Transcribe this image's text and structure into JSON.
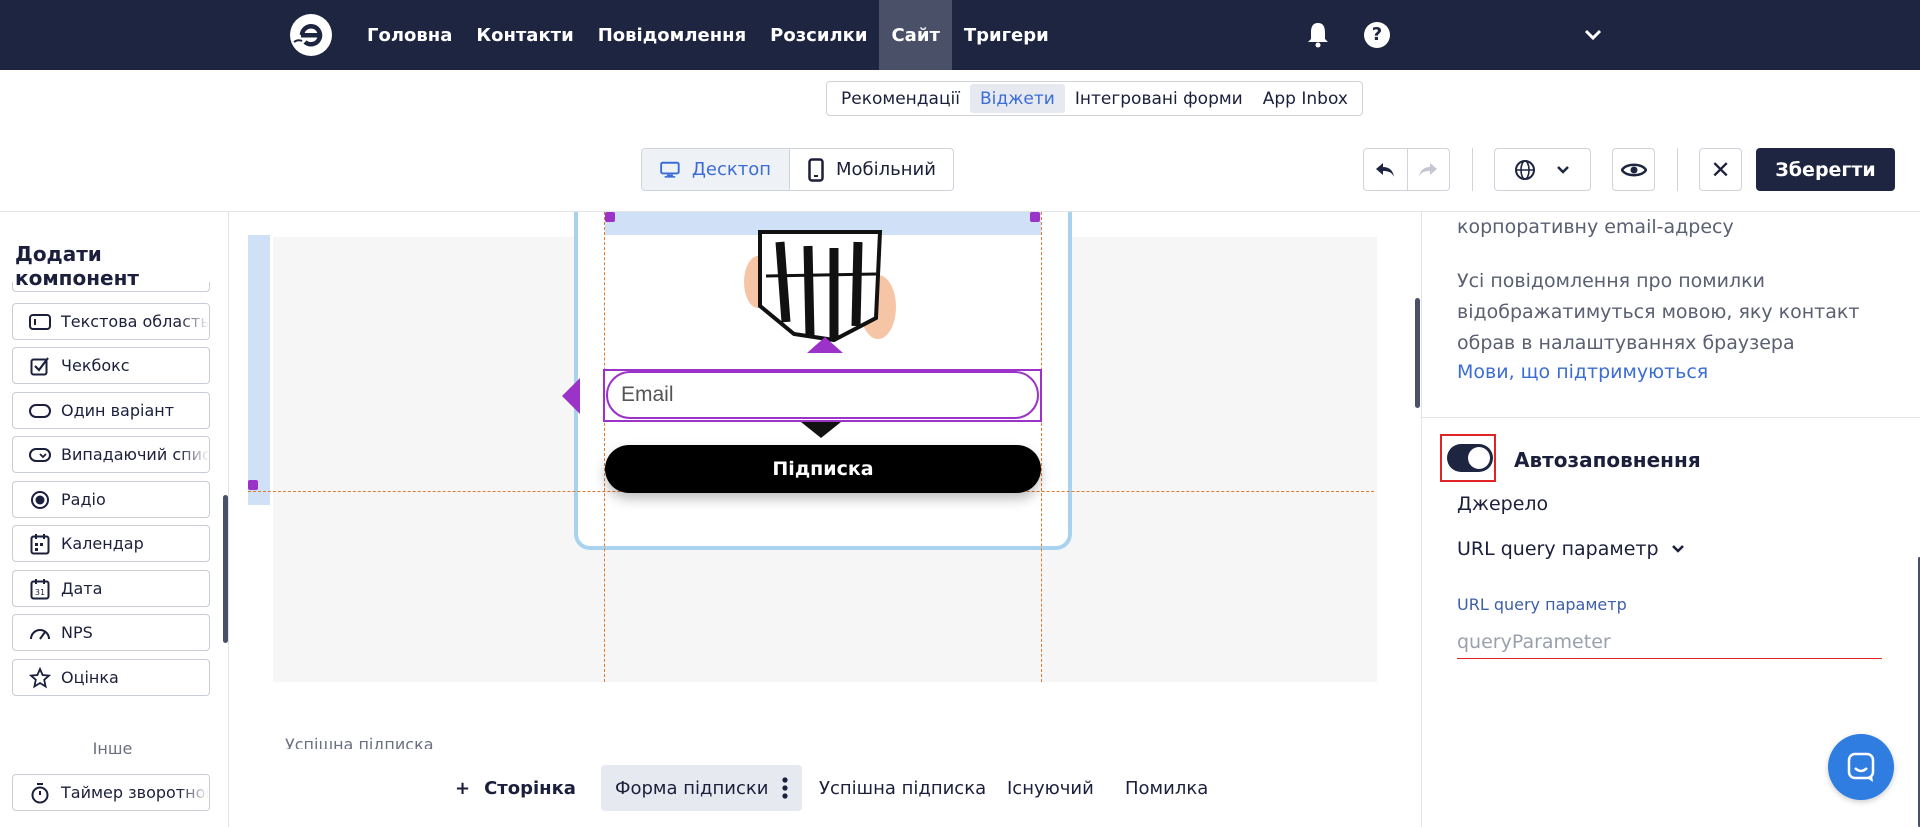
{
  "topnav": {
    "items": [
      {
        "label": "Головна",
        "active": false
      },
      {
        "label": "Контакти",
        "active": false
      },
      {
        "label": "Повідомлення",
        "active": false
      },
      {
        "label": "Розсилки",
        "active": false
      },
      {
        "label": "Сайт",
        "active": true
      },
      {
        "label": "Тригери",
        "active": false
      }
    ],
    "icons": [
      "logo-icon",
      "bell-icon",
      "help-icon",
      "chevron-down-icon"
    ]
  },
  "subtabs": [
    {
      "label": "Рекомендації",
      "active": false
    },
    {
      "label": "Віджети",
      "active": true
    },
    {
      "label": "Інтегровані форми",
      "active": false
    },
    {
      "label": "App Inbox",
      "active": false
    }
  ],
  "toolbar": {
    "desktop_label": "Десктоп",
    "mobile_label": "Мобільний",
    "save_label": "Зберегти",
    "close_symbol": "✕",
    "accent_color": "#3b6dd6",
    "dark_color": "#1d2541"
  },
  "left_panel": {
    "title": "Додати компонент",
    "components": [
      {
        "label": "Текстова область",
        "icon": "textarea-icon"
      },
      {
        "label": "Чекбокс",
        "icon": "checkbox-icon"
      },
      {
        "label": "Один варіант",
        "icon": "single-option-icon"
      },
      {
        "label": "Випадаючий список",
        "icon": "dropdown-icon"
      },
      {
        "label": "Радіо",
        "icon": "radio-icon"
      },
      {
        "label": "Календар",
        "icon": "calendar-icon"
      },
      {
        "label": "Дата",
        "icon": "date-icon"
      },
      {
        "label": "NPS",
        "icon": "gauge-icon"
      },
      {
        "label": "Оцінка",
        "icon": "star-icon"
      }
    ],
    "other_label": "Інше",
    "other_components": [
      {
        "label": "Таймер зворотного відліку",
        "icon": "timer-icon"
      }
    ]
  },
  "canvas": {
    "email_placeholder": "Email",
    "subscribe_label": "Підписка",
    "next_page_label": "Успішна підписка",
    "selection_color": "#9b33c9"
  },
  "page_tabs": {
    "add_label": "Сторінка",
    "tabs": [
      {
        "label": "Форма підписки",
        "active": true
      },
      {
        "label": "Успішна підписка",
        "active": false
      },
      {
        "label": "Існуючий",
        "active": false
      },
      {
        "label": "Помилка",
        "active": false
      }
    ]
  },
  "right_panel": {
    "text_top": "корпоративну email-адресу",
    "errors_text_lines": [
      "Усі повідомлення про помилки",
      "відображатимуться мовою, яку контакт",
      "обрав в налаштуваннях браузера"
    ],
    "languages_link": "Мови, що підтримуються",
    "autofill_label": "Автозаповнення",
    "autofill_on": true,
    "source_label": "Джерело",
    "source_value": "URL query параметр",
    "param_label": "URL query параметр",
    "param_placeholder": "queryParameter"
  }
}
